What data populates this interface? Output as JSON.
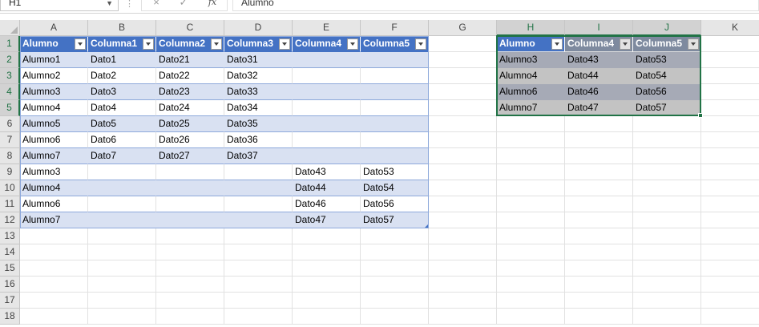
{
  "formula_bar": {
    "name_box": "H1",
    "cancel_icon": "×",
    "enter_icon": "✓",
    "fx_label": "fx",
    "formula": "Alumno"
  },
  "columns": [
    "A",
    "B",
    "C",
    "D",
    "E",
    "F",
    "G",
    "H",
    "I",
    "J",
    "K"
  ],
  "rows": [
    "1",
    "2",
    "3",
    "4",
    "5",
    "6",
    "7",
    "8",
    "9",
    "10",
    "11",
    "12",
    "13",
    "14",
    "15",
    "16",
    "17",
    "18"
  ],
  "table1": {
    "headers": [
      "Alumno",
      "Columna1",
      "Columna2",
      "Columna3",
      "Columna4",
      "Columna5"
    ],
    "rows": [
      [
        "Alumno1",
        "Dato1",
        "Dato21",
        "Dato31",
        "",
        ""
      ],
      [
        "Alumno2",
        "Dato2",
        "Dato22",
        "Dato32",
        "",
        ""
      ],
      [
        "Alumno3",
        "Dato3",
        "Dato23",
        "Dato33",
        "",
        ""
      ],
      [
        "Alumno4",
        "Dato4",
        "Dato24",
        "Dato34",
        "",
        ""
      ],
      [
        "Alumno5",
        "Dato5",
        "Dato25",
        "Dato35",
        "",
        ""
      ],
      [
        "Alumno6",
        "Dato6",
        "Dato26",
        "Dato36",
        "",
        ""
      ],
      [
        "Alumno7",
        "Dato7",
        "Dato27",
        "Dato37",
        "",
        ""
      ],
      [
        "Alumno3",
        "",
        "",
        "",
        "Dato43",
        "Dato53"
      ],
      [
        "Alumno4",
        "",
        "",
        "",
        "Dato44",
        "Dato54"
      ],
      [
        "Alumno6",
        "",
        "",
        "",
        "Dato46",
        "Dato56"
      ],
      [
        "Alumno7",
        "",
        "",
        "",
        "Dato47",
        "Dato57"
      ]
    ]
  },
  "table2": {
    "headers": [
      "Alumno",
      "Columna4",
      "Columna5"
    ],
    "rows": [
      [
        "Alumno3",
        "Dato43",
        "Dato53"
      ],
      [
        "Alumno4",
        "Dato44",
        "Dato54"
      ],
      [
        "Alumno6",
        "Dato46",
        "Dato56"
      ],
      [
        "Alumno7",
        "Dato47",
        "Dato57"
      ]
    ]
  },
  "colors": {
    "accent": "#217346",
    "table_header": "#4472c4",
    "band": "#d9e1f2"
  }
}
